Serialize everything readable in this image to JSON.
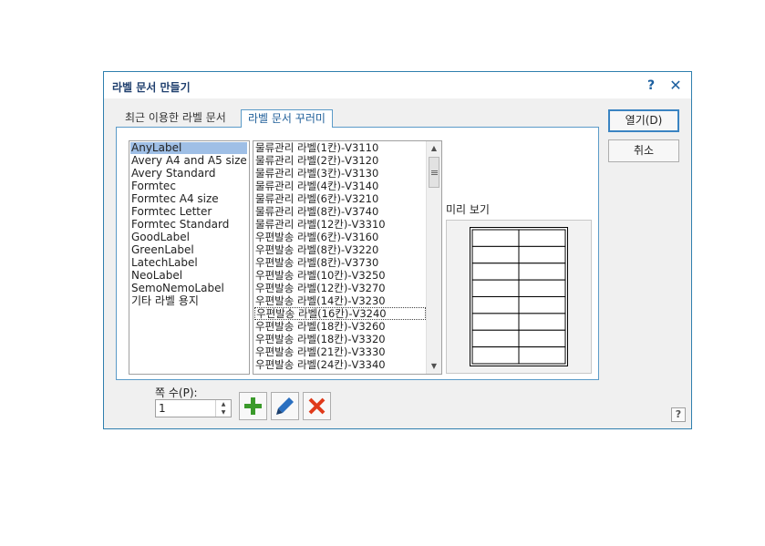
{
  "dialog": {
    "title": "라벨 문서 만들기",
    "help_label": "?",
    "close_label": "✕"
  },
  "tabs": [
    {
      "label": "최근 이용한 라벨 문서",
      "active": false
    },
    {
      "label": "라벨 문서 꾸러미",
      "active": true
    }
  ],
  "manufacturers": [
    "AnyLabel",
    "Avery A4 and A5 size",
    "Avery Standard",
    "Formtec",
    "Formtec A4 size",
    "Formtec Letter",
    "Formtec Standard",
    "GoodLabel",
    "GreenLabel",
    "LatechLabel",
    "NeoLabel",
    "SemoNemoLabel",
    "기타 라벨 용지"
  ],
  "selected_manufacturer": "AnyLabel",
  "labels": [
    "물류관리 라벨(1칸)-V3110",
    "물류관리 라벨(2칸)-V3120",
    "물류관리 라벨(3칸)-V3130",
    "물류관리 라벨(4칸)-V3140",
    "물류관리 라벨(6칸)-V3210",
    "물류관리 라벨(8칸)-V3740",
    "물류관리 라벨(12칸)-V3310",
    "우편발송 라벨(6칸)-V3160",
    "우편발송 라벨(8칸)-V3220",
    "우편발송 라벨(8칸)-V3730",
    "우편발송 라벨(10칸)-V3250",
    "우편발송 라벨(12칸)-V3270",
    "우편발송 라벨(14칸)-V3230",
    "우편발송 라벨(16칸)-V3240",
    "우편발송 라벨(18칸)-V3260",
    "우편발송 라벨(18칸)-V3320",
    "우편발송 라벨(21칸)-V3330",
    "우편발송 라벨(24칸)-V3340"
  ],
  "focused_label": "우편발송 라벨(16칸)-V3240",
  "preview": {
    "label": "미리 보기",
    "rows": 8,
    "cols": 2
  },
  "buttons": {
    "open": "열기(D)",
    "cancel": "취소"
  },
  "columns": {
    "label": "쪽 수(P):",
    "value": "1"
  },
  "toolbar": [
    {
      "name": "add-icon",
      "color": "#3a9a2a"
    },
    {
      "name": "edit-icon",
      "color": "#2a6fc0"
    },
    {
      "name": "delete-icon",
      "color": "#e03a1a"
    }
  ],
  "corner_help_label": "?"
}
